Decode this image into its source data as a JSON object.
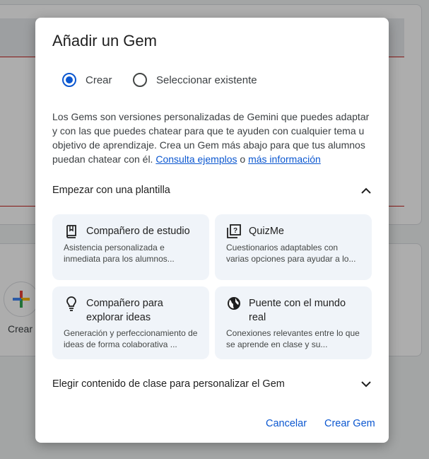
{
  "background": {
    "create_label": "Crear"
  },
  "dialog": {
    "title": "Añadir un Gem",
    "radios": [
      {
        "label": "Crear",
        "checked": true
      },
      {
        "label": "Seleccionar existente",
        "checked": false
      }
    ],
    "description": "Los Gems son versiones personalizadas de Gemini que puedes adaptar y con las que puedes chatear para que te ayuden con cualquier tema u objetivo de aprendizaje. Crea un Gem más abajo para que tus alumnos puedan chatear con él.",
    "link_examples": "Consulta ejemplos",
    "link_sep": "o",
    "link_more": "más información",
    "template_section": {
      "title": "Empezar con una plantilla",
      "state": "expanded"
    },
    "templates": [
      {
        "icon": "book-icon",
        "title": "Compañero de estudio",
        "subtitle": "Asistencia personalizada e inmediata para los alumnos..."
      },
      {
        "icon": "quiz-icon",
        "title": "QuizMe",
        "subtitle": "Cuestionarios adaptables con varias opciones para ayudar a lo..."
      },
      {
        "icon": "lightbulb-icon",
        "title": "Compañero para explorar ideas",
        "subtitle": "Generación y perfeccionamiento de ideas de forma colaborativa ..."
      },
      {
        "icon": "globe-icon",
        "title": "Puente con el mundo real",
        "subtitle": "Conexiones relevantes entre lo que se aprende en clase y su..."
      }
    ],
    "class_section": {
      "title": "Elegir contenido de clase para personalizar el Gem",
      "state": "collapsed"
    },
    "actions": {
      "cancel": "Cancelar",
      "create": "Crear Gem"
    },
    "colors": {
      "accent": "#0b57d0",
      "card_bg": "#f0f4f9"
    }
  }
}
